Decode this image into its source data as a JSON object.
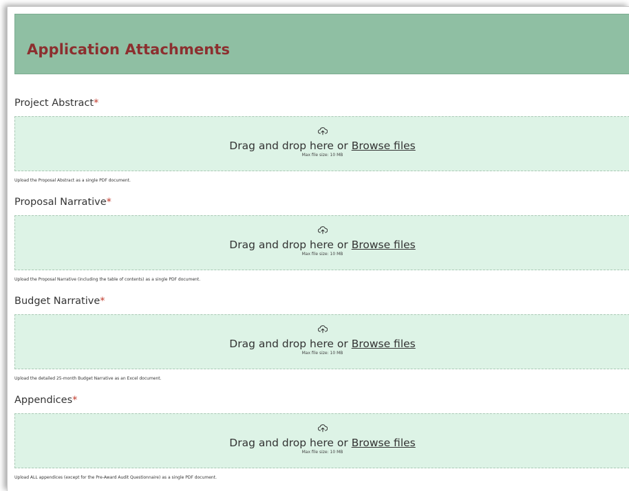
{
  "header": {
    "title": "Application Attachments"
  },
  "colors": {
    "header_bg": "#8fbfa3",
    "title_text": "#8c2f2f",
    "dropzone_bg": "#ddf3e6",
    "required_marker": "#c0392b"
  },
  "fields": [
    {
      "label": "Project Abstract",
      "required_marker": "*",
      "dropzone_icon": "upload-cloud-icon",
      "dropzone_text": "Drag and drop here or ",
      "browse_label": "Browse files",
      "max_size": "Max file size: 10 MB",
      "help": "Upload the Proposal Abstract as a single PDF document."
    },
    {
      "label": "Proposal Narrative",
      "required_marker": "*",
      "dropzone_icon": "upload-cloud-icon",
      "dropzone_text": "Drag and drop here or ",
      "browse_label": "Browse files",
      "max_size": "Max file size: 10 MB",
      "help": "Upload the Proposal Narrative (including the table of contents) as a single PDF document."
    },
    {
      "label": "Budget Narrative",
      "required_marker": "*",
      "dropzone_icon": "upload-cloud-icon",
      "dropzone_text": "Drag and drop here or ",
      "browse_label": "Browse files",
      "max_size": "Max file size: 10 MB",
      "help": "Upload the detailed 25-month Budget Narrative as an Excel document."
    },
    {
      "label": "Appendices",
      "required_marker": "*",
      "dropzone_icon": "upload-cloud-icon",
      "dropzone_text": "Drag and drop here or ",
      "browse_label": "Browse files",
      "max_size": "Max file size: 10 MB",
      "help": "Upload ALL appendices (except for the Pre-Award Audit Questionnaire) as a single PDF document."
    }
  ]
}
